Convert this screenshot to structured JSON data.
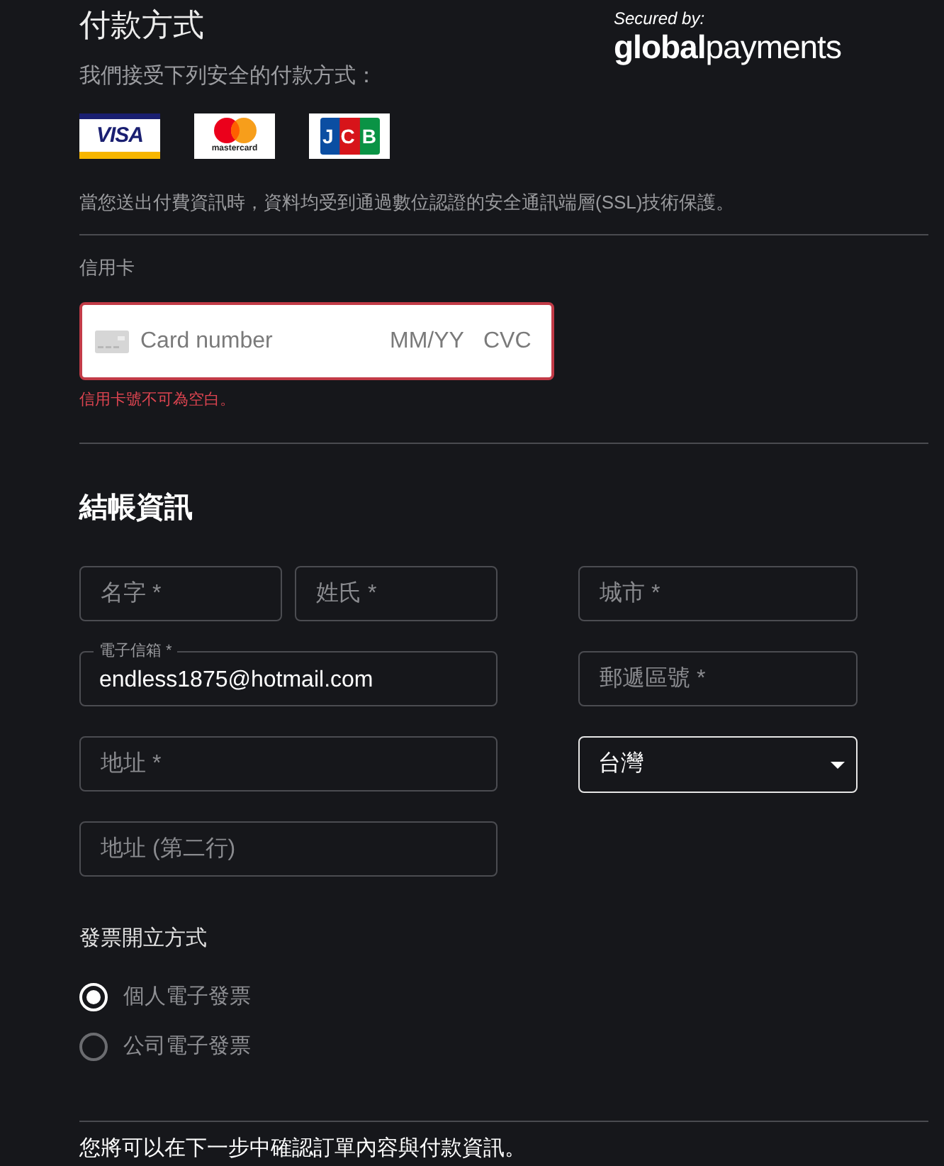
{
  "payment_methods": {
    "title": "付款方式",
    "secured_by": "Secured by:",
    "brand": "**global**payments",
    "subtitle": "我們接受下列安全的付款方式：",
    "card_logos": [
      {
        "kind": "visa",
        "text": "VISA"
      },
      {
        "kind": "mastercard",
        "text": "mastercard"
      },
      {
        "kind": "jcb",
        "text": "JCB"
      }
    ],
    "ssl_notice": "當您送出付費資訊時，資料均受到通過數位認證的安全通訊端層(SSL)技術保護。"
  },
  "credit_card": {
    "label": "信用卡",
    "invalid": true,
    "card_number": {
      "placeholder": "Card number"
    },
    "expiry": {
      "placeholder": "MM/YY"
    },
    "cvc": {
      "placeholder": "CVC"
    },
    "error": "信用卡號不可為空白。"
  },
  "billing": {
    "title": "結帳資訊",
    "left_rows": [
      [
        {
          "kind": "text",
          "placeholder": "名字 *"
        },
        {
          "kind": "text",
          "placeholder": "姓氏 *"
        }
      ],
      [
        {
          "kind": "labeled",
          "label": "電子信箱 *",
          "value": "endless1875@hotmail.com"
        }
      ],
      [
        {
          "kind": "text",
          "placeholder": "地址 *"
        }
      ],
      [
        {
          "kind": "text",
          "placeholder": "地址 (第二行)"
        }
      ]
    ],
    "right_rows": [
      [
        {
          "kind": "text",
          "placeholder": "城市 *"
        }
      ],
      [
        {
          "kind": "text",
          "placeholder": "郵遞區號 *"
        }
      ],
      [
        {
          "kind": "select",
          "value": "台灣"
        }
      ]
    ]
  },
  "invoice": {
    "title": "發票開立方式",
    "options": [
      {
        "label": "個人電子發票",
        "selected": true
      },
      {
        "label": "公司電子發票",
        "selected": false
      }
    ]
  },
  "footer_note": "您將可以在下一步中確認訂單內容與付款資訊。"
}
